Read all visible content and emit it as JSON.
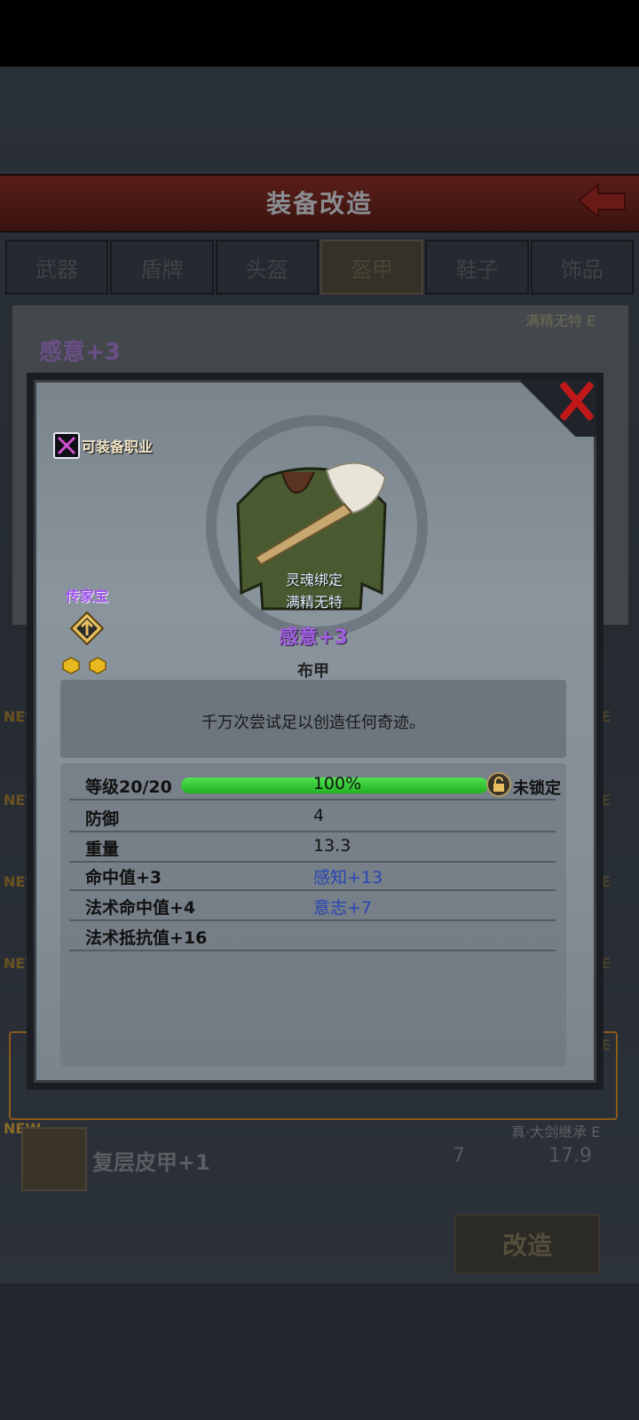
{
  "header": {
    "title": "装备改造"
  },
  "tabs": [
    "武器",
    "盾牌",
    "头盔",
    "盔甲",
    "鞋子",
    "饰品"
  ],
  "active_tab": "盔甲",
  "background_card": {
    "name": "感意+3",
    "tag": "满精无特",
    "tag_grade": "E"
  },
  "background_rows": {
    "new_label": "NEW",
    "grade": "E"
  },
  "bottom_item": {
    "new_label": "NEW",
    "name": "复层皮甲+1",
    "defense": "7",
    "weight": "17.9",
    "tag": "真·大剑继承",
    "grade": "E"
  },
  "modify_button": "改造",
  "modal": {
    "job_label": "可装备职业",
    "binding_1": "灵魂绑定",
    "binding_2": "满精无特",
    "heirloom_label": "传家宝",
    "item_name": "感意+3",
    "item_type": "布甲",
    "description": "千万次尝试足以创造任何奇迹。",
    "level_label": "等级20/20",
    "level_progress": 1.0,
    "level_percent_text": "100%",
    "lock_label": "未锁定",
    "stats": [
      {
        "label": "防御",
        "value": "4"
      },
      {
        "label": "重量",
        "value": "13.3"
      },
      {
        "label": "命中值+3",
        "value": "感知+13"
      },
      {
        "label": "法术命中值+4",
        "value": "意志+7"
      },
      {
        "label": "法术抵抗值+16",
        "value": ""
      }
    ]
  },
  "colors": {
    "rarity_purple": "#a060e0",
    "progress_green": "#3ccc3c",
    "close_red": "#c01818"
  }
}
